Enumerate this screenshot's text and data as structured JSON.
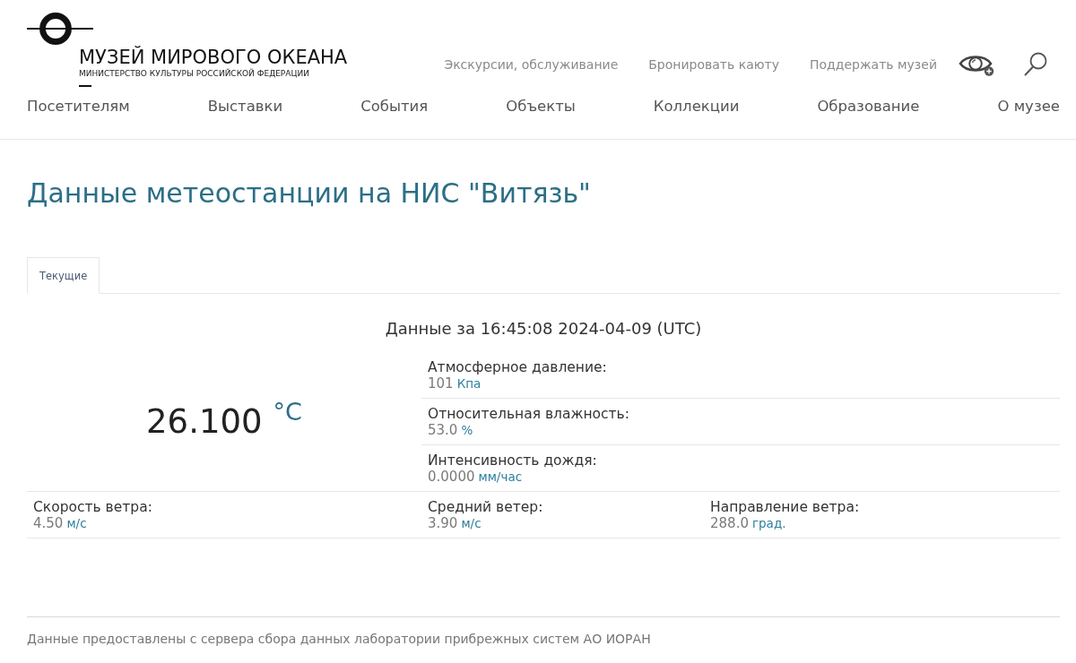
{
  "header": {
    "logo": {
      "title": "МУЗЕЙ МИРОВОГО ОКЕАНА",
      "subtitle": "МИНИСТЕРСТВО КУЛЬТУРЫ РОССИЙСКОЙ ФЕДЕРАЦИИ"
    },
    "utility_links": [
      "Экскурсии, обслуживание",
      "Бронировать каюту",
      "Поддержать музей"
    ],
    "nav": [
      "Посетителям",
      "Выставки",
      "События",
      "Объекты",
      "Коллекции",
      "Образование",
      "О музее"
    ]
  },
  "page_title": "Данные метеостанции на НИС \"Витязь\"",
  "tabs": [
    {
      "label": "Текущие",
      "selected": true
    }
  ],
  "weather": {
    "timestamp": "Данные за 16:45:08 2024-04-09 (UTC)",
    "temperature": {
      "value": "26.100",
      "unit": "°C"
    },
    "readings": [
      {
        "label": "Атмосферное давление:",
        "value": "101",
        "unit": "Кпа"
      },
      {
        "label": "Относительная влажность:",
        "value": "53.0",
        "unit": "%"
      },
      {
        "label": "Интенсивность дождя:",
        "value": "0.0000",
        "unit": "мм/час"
      }
    ],
    "wind": [
      {
        "label": "Скорость ветра:",
        "value": "4.50",
        "unit": "м/с"
      },
      {
        "label": "Средний ветер:",
        "value": "3.90",
        "unit": "м/с"
      },
      {
        "label": "Направление ветра:",
        "value": "288.0",
        "unit": "град."
      }
    ]
  },
  "footer": {
    "note": "Данные предоставлены с сервера сбора данных лаборатории прибрежных систем АО ИОРАН"
  }
}
